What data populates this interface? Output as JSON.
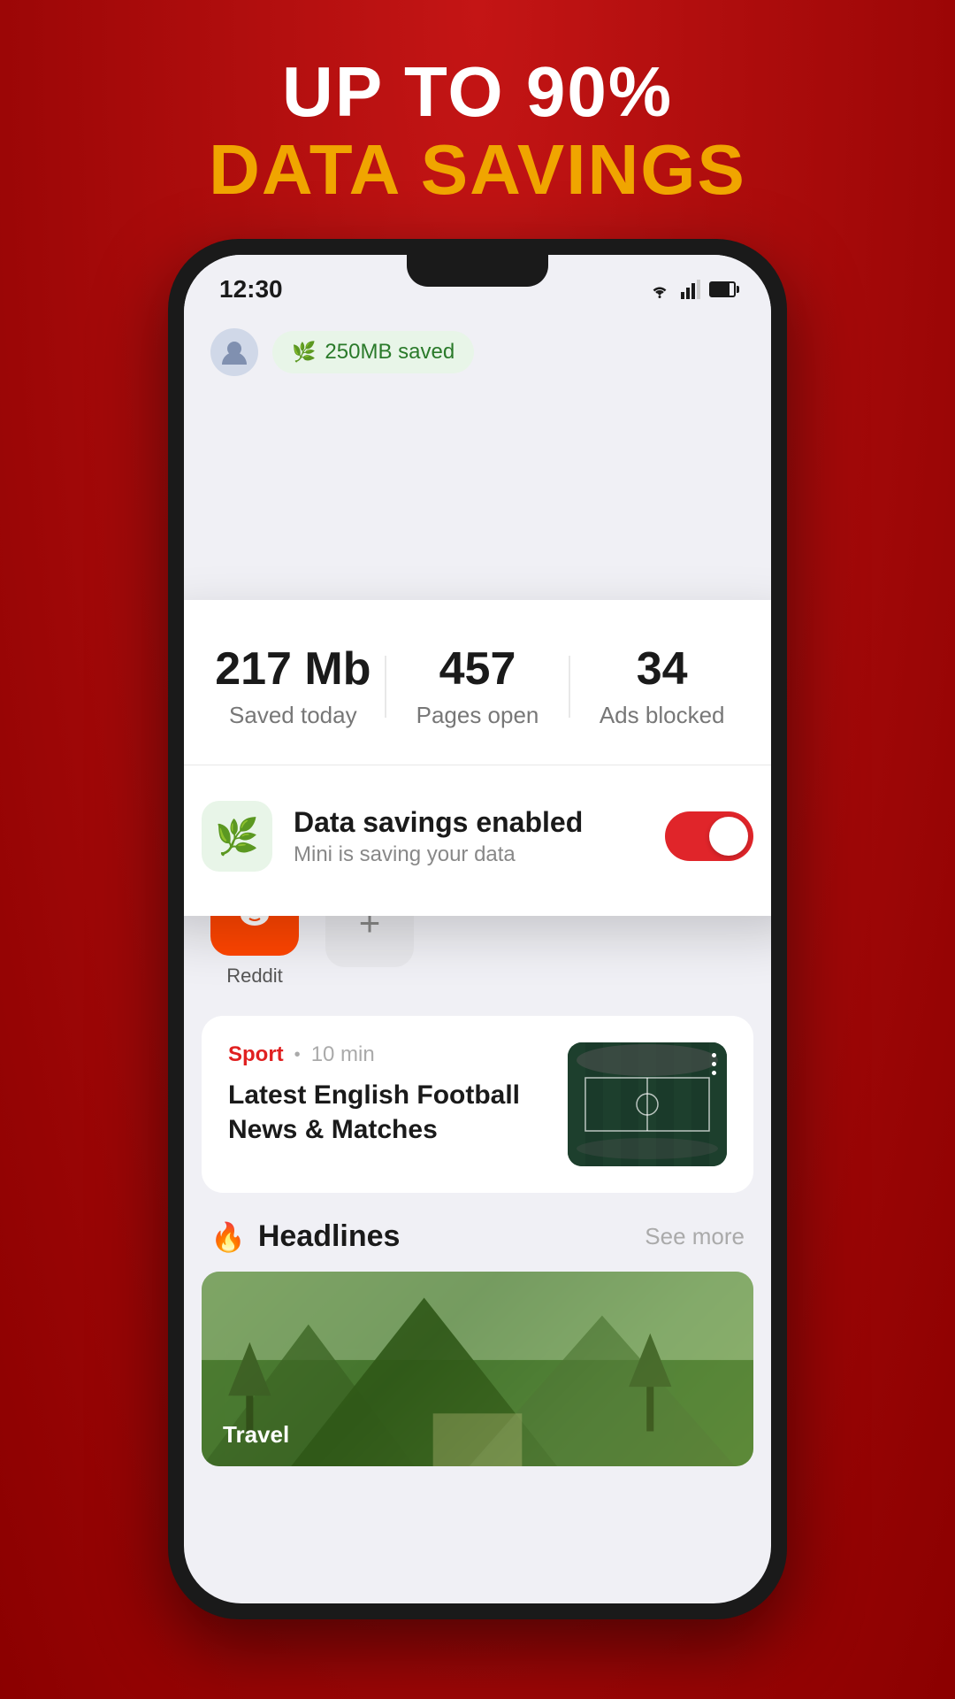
{
  "headline": {
    "line1": "UP TO 90%",
    "line2": "DATA SAVINGS"
  },
  "status_bar": {
    "time": "12:30",
    "wifi": true,
    "signal": true,
    "battery": true
  },
  "browser_bar": {
    "data_saved_badge": "250MB saved"
  },
  "stats_card": {
    "stat1_value": "217 Mb",
    "stat1_label": "Saved today",
    "stat2_value": "457",
    "stat2_label": "Pages open",
    "stat3_value": "34",
    "stat3_label": "Ads blocked",
    "savings_title": "Data savings enabled",
    "savings_subtitle": "Mini is saving your data",
    "toggle_enabled": true
  },
  "shortcuts": [
    {
      "label": "Reddit",
      "type": "reddit"
    },
    {
      "label": "",
      "type": "add"
    }
  ],
  "news_item": {
    "category": "Sport",
    "time": "10 min",
    "title": "Latest English Football News & Matches"
  },
  "headlines": {
    "title": "Headlines",
    "see_more": "See more",
    "image_label": "Travel"
  }
}
